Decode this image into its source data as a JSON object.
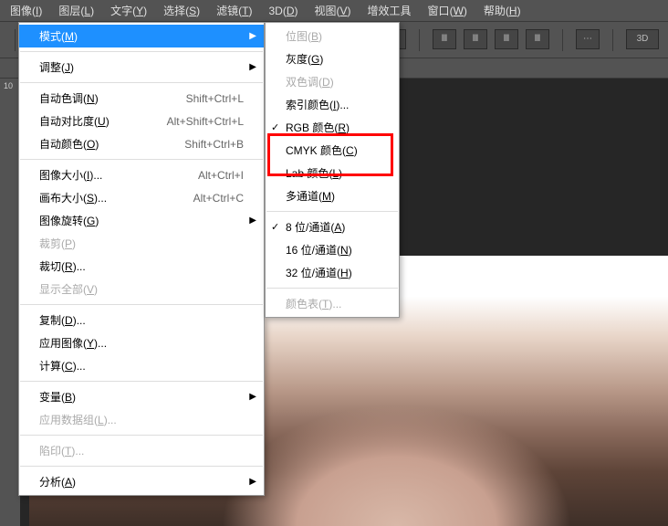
{
  "menubar": {
    "items": [
      {
        "label": "图像",
        "key": "I"
      },
      {
        "label": "图层",
        "key": "L"
      },
      {
        "label": "文字",
        "key": "Y"
      },
      {
        "label": "选择",
        "key": "S"
      },
      {
        "label": "滤镜",
        "key": "T"
      },
      {
        "label": "3D",
        "key": "D"
      },
      {
        "label": "视图",
        "key": "V"
      },
      {
        "label": "增效工具",
        "key": ""
      },
      {
        "label": "窗口",
        "key": "W"
      },
      {
        "label": "帮助",
        "key": "H"
      }
    ]
  },
  "toolbar_3d": "3D",
  "ruler": {
    "value": "10"
  },
  "image_menu": {
    "mode": {
      "label": "模式",
      "key": "M"
    },
    "adjust": {
      "label": "调整",
      "key": "J"
    },
    "auto_tone": {
      "label": "自动色调",
      "key": "N",
      "shortcut": "Shift+Ctrl+L"
    },
    "auto_contrast": {
      "label": "自动对比度",
      "key": "U",
      "shortcut": "Alt+Shift+Ctrl+L"
    },
    "auto_color": {
      "label": "自动颜色",
      "key": "O",
      "shortcut": "Shift+Ctrl+B"
    },
    "image_size": {
      "label": "图像大小",
      "key": "I",
      "shortcut": "Alt+Ctrl+I",
      "suffix": "..."
    },
    "canvas_size": {
      "label": "画布大小",
      "key": "S",
      "shortcut": "Alt+Ctrl+C",
      "suffix": "..."
    },
    "rotation": {
      "label": "图像旋转",
      "key": "G"
    },
    "crop": {
      "label": "裁剪",
      "key": "P"
    },
    "trim": {
      "label": "裁切",
      "key": "R",
      "suffix": "..."
    },
    "reveal_all": {
      "label": "显示全部",
      "key": "V"
    },
    "duplicate": {
      "label": "复制",
      "key": "D",
      "suffix": "..."
    },
    "apply_image": {
      "label": "应用图像",
      "key": "Y",
      "suffix": "..."
    },
    "calculations": {
      "label": "计算",
      "key": "C",
      "suffix": "..."
    },
    "variables": {
      "label": "变量",
      "key": "B"
    },
    "apply_dataset": {
      "label": "应用数据组",
      "key": "L",
      "suffix": "..."
    },
    "trap": {
      "label": "陷印",
      "key": "T",
      "suffix": "..."
    },
    "analysis": {
      "label": "分析",
      "key": "A"
    }
  },
  "mode_menu": {
    "bitmap": {
      "label": "位图",
      "key": "B"
    },
    "grayscale": {
      "label": "灰度",
      "key": "G"
    },
    "duotone": {
      "label": "双色调",
      "key": "D"
    },
    "indexed": {
      "label": "索引颜色",
      "key": "I",
      "suffix": "..."
    },
    "rgb": {
      "label": "RGB 颜色",
      "key": "R"
    },
    "cmyk": {
      "label": "CMYK 颜色",
      "key": "C"
    },
    "lab": {
      "label": "Lab 颜色",
      "key": "L"
    },
    "multichannel": {
      "label": "多通道",
      "key": "M"
    },
    "bit8": {
      "label": "8 位/通道",
      "key": "A"
    },
    "bit16": {
      "label": "16 位/通道",
      "key": "N"
    },
    "bit32": {
      "label": "32 位/通道",
      "key": "H"
    },
    "color_table": {
      "label": "颜色表",
      "key": "T",
      "suffix": "..."
    }
  }
}
